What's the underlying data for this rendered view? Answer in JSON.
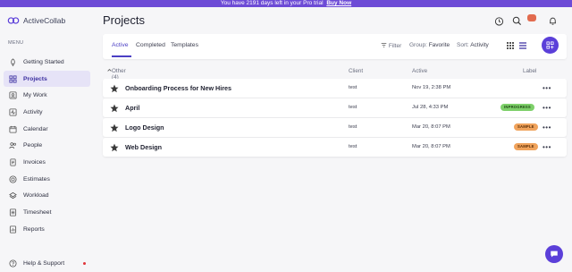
{
  "banner": {
    "text": "You have 2191 days left in your Pro trial",
    "cta": "Buy Now"
  },
  "app": {
    "name": "ActiveCollab"
  },
  "sidebar": {
    "menu_heading": "MENU",
    "items": [
      {
        "label": "Getting Started",
        "icon": "rocket-icon"
      },
      {
        "label": "Projects",
        "icon": "grid-icon",
        "active": true
      },
      {
        "label": "My Work",
        "icon": "person-icon"
      },
      {
        "label": "Activity",
        "icon": "activity-icon"
      },
      {
        "label": "Calendar",
        "icon": "calendar-icon"
      },
      {
        "label": "People",
        "icon": "people-icon"
      },
      {
        "label": "Invoices",
        "icon": "invoice-icon"
      },
      {
        "label": "Estimates",
        "icon": "estimate-icon"
      },
      {
        "label": "Workload",
        "icon": "workload-icon"
      },
      {
        "label": "Timesheet",
        "icon": "timesheet-icon"
      },
      {
        "label": "Reports",
        "icon": "reports-icon"
      }
    ],
    "help": "Help & Support"
  },
  "page": {
    "title": "Projects"
  },
  "toolbar": {
    "tabs": [
      "Active",
      "Completed",
      "Templates"
    ],
    "filter": "Filter",
    "group_label": "Group:",
    "group_value": "Favorite",
    "sort_label": "Sort:",
    "sort_value": "Activity"
  },
  "table": {
    "group_header": "Other (4)",
    "columns": {
      "client": "Client",
      "active": "Active",
      "label": "Label"
    },
    "rows": [
      {
        "name": "Onboarding Process for New Hires",
        "client": "test",
        "active": "Nov 19, 2:38 PM",
        "label": ""
      },
      {
        "name": "April",
        "client": "test",
        "active": "Jul 28, 4:33 PM",
        "label": "INPROGRESS",
        "label_color": "#7ed06a"
      },
      {
        "name": "Logo Design",
        "client": "test",
        "active": "Mar 20, 8:07 PM",
        "label": "SAMPLE",
        "label_color": "#f0a35c"
      },
      {
        "name": "Web Design",
        "client": "test",
        "active": "Mar 20, 8:07 PM",
        "label": "SAMPLE",
        "label_color": "#f0a35c"
      }
    ]
  },
  "colors": {
    "accent": "#5b3fd9",
    "banner": "#6d4bd6",
    "active_nav_bg": "#e6e3f7"
  }
}
